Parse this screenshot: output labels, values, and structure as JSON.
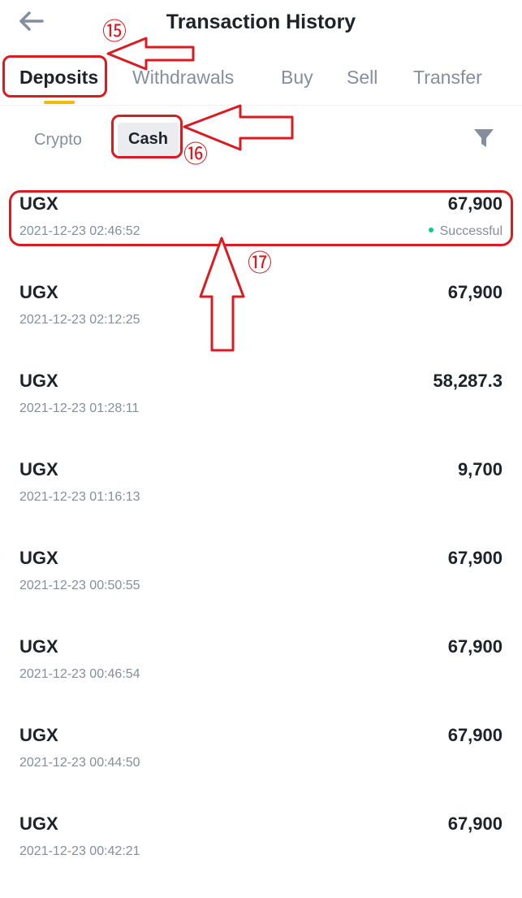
{
  "header": {
    "title": "Transaction History",
    "back_icon": "arrow-left-icon"
  },
  "tabs": [
    {
      "label": "Deposits",
      "active": true
    },
    {
      "label": "Withdrawals",
      "active": false
    },
    {
      "label": "Buy",
      "active": false
    },
    {
      "label": "Sell",
      "active": false
    },
    {
      "label": "Transfer",
      "active": false
    }
  ],
  "subtabs": [
    {
      "label": "Crypto",
      "active": false
    },
    {
      "label": "Cash",
      "active": true
    }
  ],
  "filter_icon": "filter-funnel-icon",
  "transactions": [
    {
      "currency": "UGX",
      "time": "2021-12-23 02:46:52",
      "amount": "67,900",
      "status": "Successful"
    },
    {
      "currency": "UGX",
      "time": "2021-12-23 02:12:25",
      "amount": "67,900",
      "status": ""
    },
    {
      "currency": "UGX",
      "time": "2021-12-23 01:28:11",
      "amount": "58,287.3",
      "status": ""
    },
    {
      "currency": "UGX",
      "time": "2021-12-23 01:16:13",
      "amount": "9,700",
      "status": ""
    },
    {
      "currency": "UGX",
      "time": "2021-12-23 00:50:55",
      "amount": "67,900",
      "status": ""
    },
    {
      "currency": "UGX",
      "time": "2021-12-23 00:46:54",
      "amount": "67,900",
      "status": ""
    },
    {
      "currency": "UGX",
      "time": "2021-12-23 00:44:50",
      "amount": "67,900",
      "status": ""
    },
    {
      "currency": "UGX",
      "time": "2021-12-23 00:42:21",
      "amount": "67,900",
      "status": ""
    }
  ],
  "annotations": {
    "color": "#d81c22",
    "step15": "⑮",
    "step16": "⑯",
    "step17": "⑰"
  },
  "colors": {
    "accent": "#f0b90b",
    "success": "#0ecb81",
    "text_primary": "#1e2329",
    "text_secondary": "#848e9c"
  }
}
